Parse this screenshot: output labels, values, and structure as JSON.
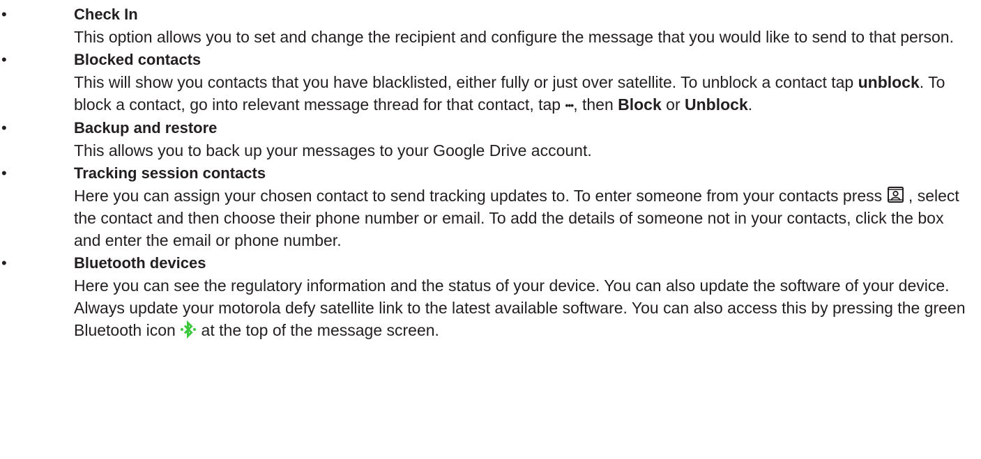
{
  "items": [
    {
      "bullet": "•",
      "title": "Check In",
      "text": "This option allows you to set and change the recipient and configure the message that you would like to send to that person."
    },
    {
      "bullet": "•",
      "title": "Blocked contacts",
      "p1": "This will show you contacts that you have blacklisted, either fully or just over satellite. To unblock a contact tap ",
      "b1": "unblock",
      "p2": ".  To block a contact, go into relevant message thread for that contact, tap ",
      "dots": "•••",
      "p3": ", then ",
      "b2": "Block",
      "p4": " or ",
      "b3": "Unblock",
      "p5": "."
    },
    {
      "bullet": "•",
      "title": "Backup and restore",
      "text": "This allows you to back up your messages to your Google Drive account."
    },
    {
      "bullet": "•",
      "title": "Tracking session contacts",
      "p1": "Here you can assign your chosen contact to send tracking updates to. To enter someone from your contacts press ",
      "icon": "contacts-icon",
      "p2": " , select the contact and then choose their phone number or email. To add the details of someone not in your contacts, click the box and enter the email or phone number."
    },
    {
      "bullet": "•",
      "title": "Bluetooth devices",
      "p1": "Here you can see the regulatory information and the status of your device. You can also update the software of your device. Always update your motorola defy satellite link to the latest available software. You can also access this by pressing the green Bluetooth icon ",
      "icon": "bluetooth-icon",
      "p2": " at the top of the message screen."
    }
  ],
  "colors": {
    "text": "#231f20",
    "bluetooth_green": "#3cc83c"
  }
}
